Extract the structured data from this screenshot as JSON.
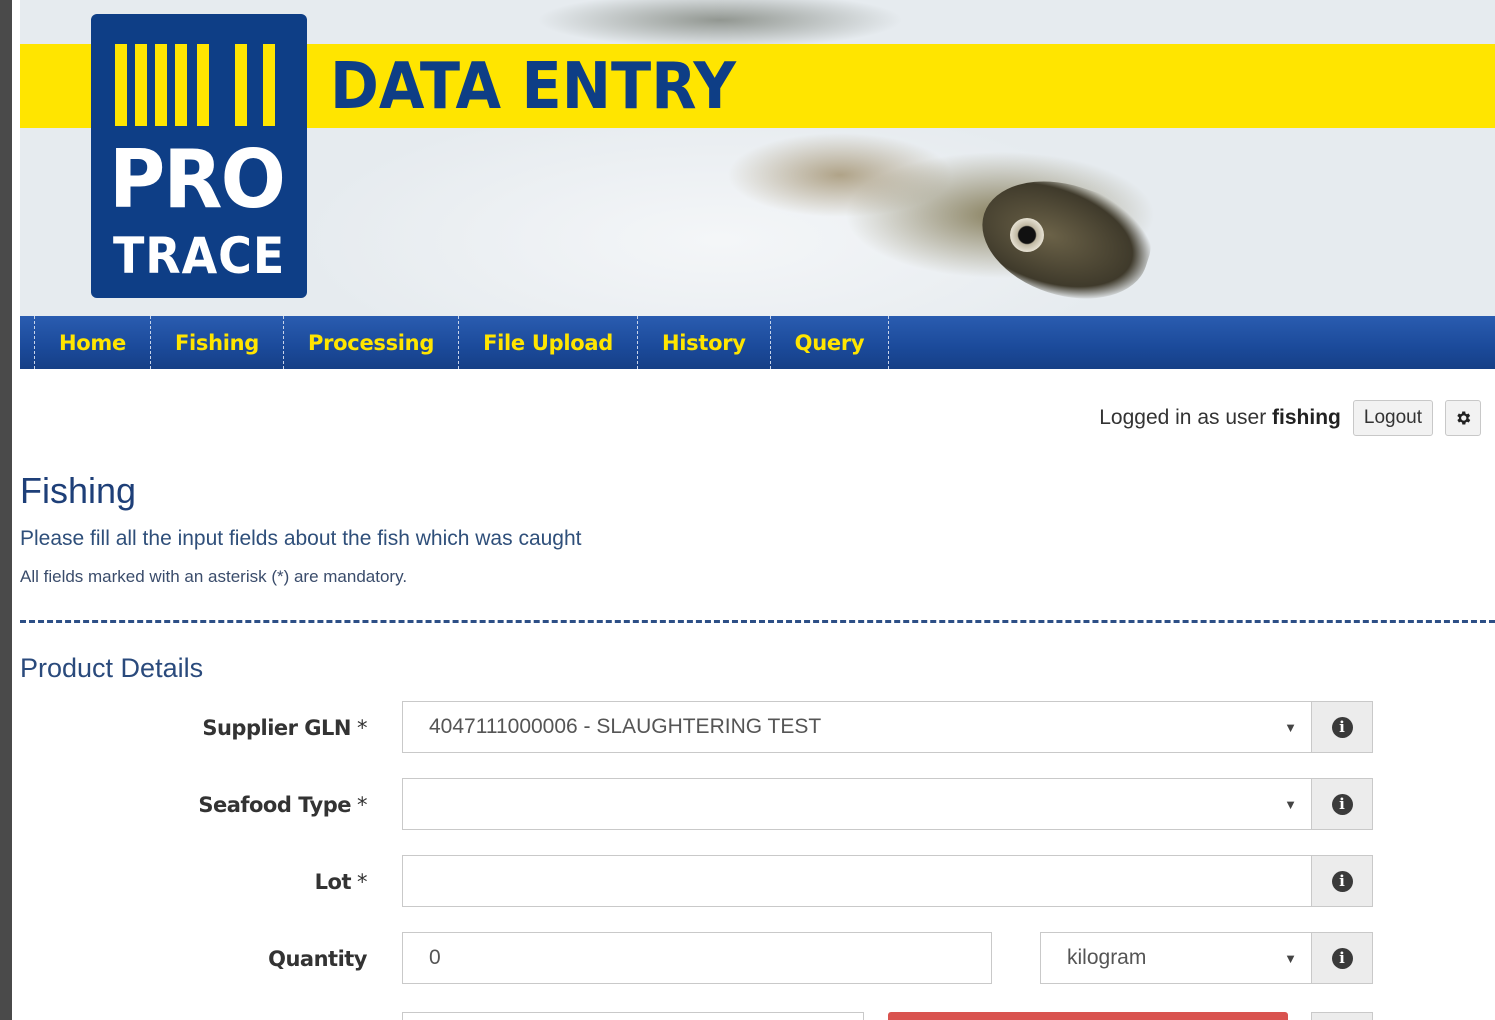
{
  "banner": {
    "title": "DATA ENTRY",
    "logo": {
      "line1": "PRO",
      "line2": "TRACE"
    }
  },
  "nav": {
    "items": [
      {
        "label": "Home"
      },
      {
        "label": "Fishing"
      },
      {
        "label": "Processing"
      },
      {
        "label": "File Upload"
      },
      {
        "label": "History"
      },
      {
        "label": "Query"
      }
    ]
  },
  "user": {
    "prefix": "Logged in as user",
    "username": "fishing",
    "logout_label": "Logout",
    "settings_icon": "gear-icon"
  },
  "page": {
    "title": "Fishing",
    "description": "Please fill all the input fields about the fish which was caught",
    "note": "All fields marked with an asterisk (*) are mandatory."
  },
  "section": {
    "title": "Product Details"
  },
  "form": {
    "supplier_gln": {
      "label": "Supplier GLN",
      "required_mark": "*",
      "value": "4047111000006 - SLAUGHTERING TEST"
    },
    "seafood_type": {
      "label": "Seafood Type",
      "required_mark": "*",
      "value": ""
    },
    "lot": {
      "label": "Lot",
      "required_mark": "*",
      "value": ""
    },
    "quantity": {
      "label": "Quantity",
      "value": "0",
      "unit": "kilogram"
    }
  },
  "colors": {
    "brand_blue": "#0e3e86",
    "brand_yellow": "#ffe500",
    "nav_blue": "#1b4a9a",
    "danger_red": "#d9534f"
  }
}
